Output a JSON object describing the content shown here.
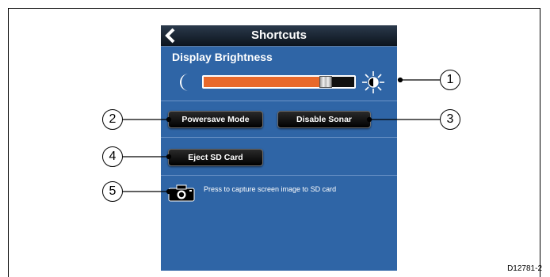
{
  "header": {
    "title": "Shortcuts",
    "back_icon": "chevron-left-icon"
  },
  "brightness": {
    "section_label": "Display Brightness",
    "level_fraction": 0.8,
    "low_icon": "moon-icon",
    "high_icon": "sun-icon"
  },
  "buttons": {
    "powersave_label": "Powersave Mode",
    "disable_sonar_label": "Disable Sonar",
    "eject_sd_label": "Eject SD Card"
  },
  "capture": {
    "icon": "camera-icon",
    "text": "Press to capture screen image to SD card"
  },
  "callouts": [
    "1",
    "2",
    "3",
    "4",
    "5"
  ],
  "figure_id": "D12781-2",
  "colors": {
    "screen_bg": "#2f65a6",
    "slider_fill": "#e8692b",
    "titlebar": "#0c141d"
  }
}
